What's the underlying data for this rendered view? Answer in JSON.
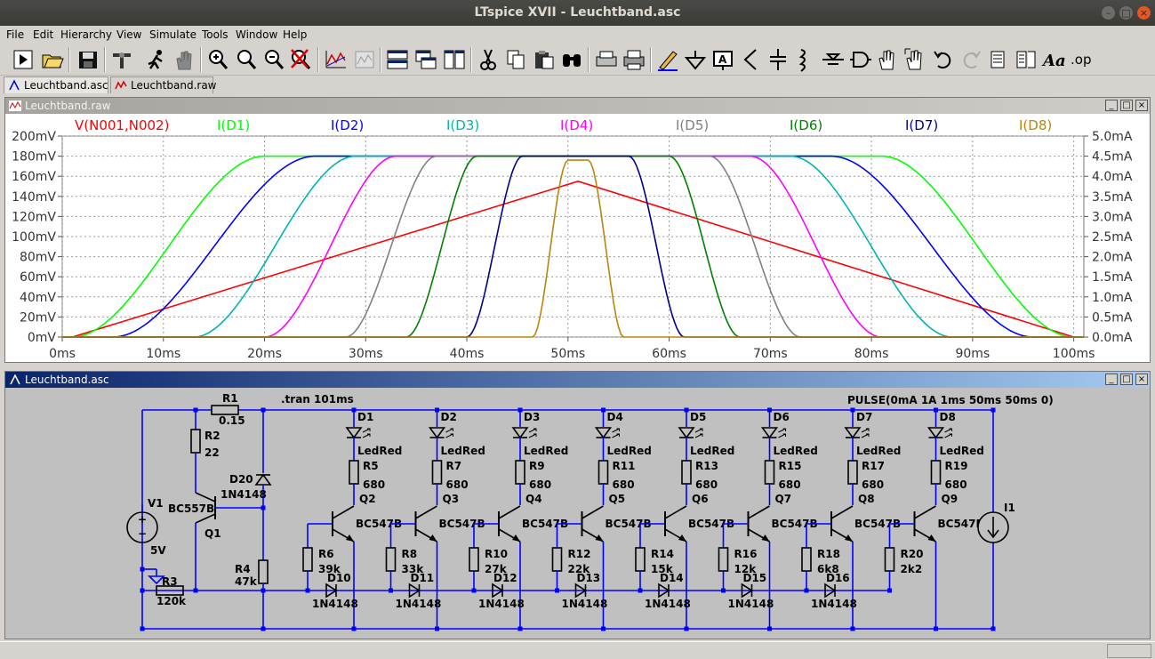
{
  "window": {
    "title": "LTspice XVII - Leuchtband.asc",
    "controls": [
      "–",
      "□",
      "×"
    ]
  },
  "menu": [
    "File",
    "Edit",
    "Hierarchy",
    "View",
    "Simulate",
    "Tools",
    "Window",
    "Help"
  ],
  "toolbar_icons": [
    "run-icon",
    "open-icon",
    "save-icon",
    "control-panel-icon",
    "halt-icon",
    "pan-icon",
    "zoom-in-icon",
    "zoom-area-icon",
    "zoom-out-icon",
    "zoom-cancel-icon",
    "autorange-icon",
    "waveform-icon",
    "tile-horizontal-icon",
    "cascade-icon",
    "tile-vertical-icon",
    "cut-icon",
    "copy-icon",
    "paste-icon",
    "find-icon",
    "print-preview-icon",
    "print-icon",
    "draw-wire-icon",
    "ground-icon",
    "label-net-icon",
    "resistor-icon",
    "capacitor-icon",
    "inductor-icon",
    "diode-icon",
    "component-icon",
    "move-icon",
    "drag-icon",
    "undo-icon",
    "redo-icon",
    "rotate-icon",
    "mirror-icon",
    "text-icon",
    "spice-directive-icon"
  ],
  "toolbar_text": {
    "spice_directive": ".op"
  },
  "tabs": [
    {
      "label": "Leuchtband.asc",
      "icon": "schematic-icon",
      "active": true
    },
    {
      "label": "Leuchtband.raw",
      "icon": "waveform-icon",
      "active": false
    }
  ],
  "plot_window": {
    "title": "Leuchtband.raw"
  },
  "schematic_window": {
    "title": "Leuchtband.asc"
  },
  "chart_data": {
    "type": "line",
    "xlabel": "",
    "ylabel": "",
    "xlim": [
      0,
      101
    ],
    "x_ticks": [
      "0ms",
      "10ms",
      "20ms",
      "30ms",
      "40ms",
      "50ms",
      "60ms",
      "70ms",
      "80ms",
      "90ms",
      "100ms"
    ],
    "left_axis": {
      "ticks": [
        "0mV",
        "20mV",
        "40mV",
        "60mV",
        "80mV",
        "100mV",
        "120mV",
        "140mV",
        "160mV",
        "180mV",
        "200mV"
      ],
      "ylim": [
        0,
        200
      ],
      "unit": "mV"
    },
    "right_axis": {
      "ticks": [
        "0.0mA",
        "0.5mA",
        "1.0mA",
        "1.5mA",
        "2.0mA",
        "2.5mA",
        "3.0mA",
        "3.5mA",
        "4.0mA",
        "4.5mA",
        "5.0mA"
      ],
      "ylim": [
        0,
        5.0
      ],
      "unit": "mA"
    },
    "grid": true,
    "series": [
      {
        "name": "V(N001,N002)",
        "color": "#ff0000",
        "axis": "left",
        "shape": "triangle",
        "x": [
          1,
          51,
          100
        ],
        "y": [
          0,
          155,
          0
        ]
      },
      {
        "name": "I(D1)",
        "color": "#00ff00",
        "axis": "right",
        "rise": [
          1,
          20
        ],
        "fall": [
          81,
          100
        ],
        "plateau": 4.5
      },
      {
        "name": "I(D2)",
        "color": "#0000ff",
        "axis": "right",
        "rise": [
          5,
          25
        ],
        "fall": [
          76,
          96
        ],
        "plateau": 4.5
      },
      {
        "name": "I(D3)",
        "color": "#00b4b4",
        "axis": "right",
        "rise": [
          13,
          29
        ],
        "fall": [
          72,
          88
        ],
        "plateau": 4.5
      },
      {
        "name": "I(D4)",
        "color": "#ff00ff",
        "axis": "right",
        "rise": [
          20,
          33
        ],
        "fall": [
          68,
          81
        ],
        "plateau": 4.5
      },
      {
        "name": "I(D5)",
        "color": "#808080",
        "axis": "right",
        "rise": [
          28,
          37
        ],
        "fall": [
          64,
          73
        ],
        "plateau": 4.5
      },
      {
        "name": "I(D6)",
        "color": "#008000",
        "axis": "right",
        "rise": [
          34,
          41
        ],
        "fall": [
          60,
          67
        ],
        "plateau": 4.5
      },
      {
        "name": "I(D7)",
        "color": "#00008b",
        "axis": "right",
        "rise": [
          40,
          45.5
        ],
        "fall": [
          56,
          61.5
        ],
        "plateau": 4.5
      },
      {
        "name": "I(D8)",
        "color": "#b8860b",
        "axis": "right",
        "rise": [
          46.5,
          50
        ],
        "fall": [
          52,
          55.5
        ],
        "plateau": 4.4
      }
    ]
  },
  "schematic": {
    "directive": ".tran 101ms",
    "source_spec": "PULSE(0mA 1A 1ms 50ms 50ms 0)",
    "labels": {
      "R1": "R1",
      "R1v": "0.15",
      "R2": "R2",
      "R2v": "22",
      "R3": "R3",
      "R3v": "120k",
      "R4": "R4",
      "R4v": "47k",
      "D20": "D20",
      "D20v": "1N4148",
      "V1": "V1",
      "V1v": "5V",
      "Q1": "Q1",
      "Q1v": "BC557B",
      "I1": "I1"
    },
    "stages": [
      {
        "d": "D1",
        "dv": "LedRed",
        "rc": "R5",
        "rcv": "680",
        "q": "Q2",
        "qv": "BC547B",
        "rb": "R6",
        "rbv": "39k",
        "dd": "D10",
        "ddv": "1N4148"
      },
      {
        "d": "D2",
        "dv": "LedRed",
        "rc": "R7",
        "rcv": "680",
        "q": "Q3",
        "qv": "BC547B",
        "rb": "R8",
        "rbv": "33k",
        "dd": "D11",
        "ddv": "1N4148"
      },
      {
        "d": "D3",
        "dv": "LedRed",
        "rc": "R9",
        "rcv": "680",
        "q": "Q4",
        "qv": "BC547B",
        "rb": "R10",
        "rbv": "27k",
        "dd": "D12",
        "ddv": "1N4148"
      },
      {
        "d": "D4",
        "dv": "LedRed",
        "rc": "R11",
        "rcv": "680",
        "q": "Q5",
        "qv": "BC547B",
        "rb": "R12",
        "rbv": "22k",
        "dd": "D13",
        "ddv": "1N4148"
      },
      {
        "d": "D5",
        "dv": "LedRed",
        "rc": "R13",
        "rcv": "680",
        "q": "Q6",
        "qv": "BC547B",
        "rb": "R14",
        "rbv": "15k",
        "dd": "D14",
        "ddv": "1N4148"
      },
      {
        "d": "D6",
        "dv": "LedRed",
        "rc": "R15",
        "rcv": "680",
        "q": "Q7",
        "qv": "BC547B",
        "rb": "R16",
        "rbv": "12k",
        "dd": "D15",
        "ddv": "1N4148"
      },
      {
        "d": "D7",
        "dv": "LedRed",
        "rc": "R17",
        "rcv": "680",
        "q": "Q8",
        "qv": "BC547B",
        "rb": "R18",
        "rbv": "6k8",
        "dd": "D16",
        "ddv": "1N4148"
      },
      {
        "d": "D8",
        "dv": "LedRed",
        "rc": "R19",
        "rcv": "680",
        "q": "Q9",
        "qv": "BC547B",
        "rb": "R20",
        "rbv": "2k2",
        "dd": "",
        "ddv": ""
      }
    ]
  }
}
